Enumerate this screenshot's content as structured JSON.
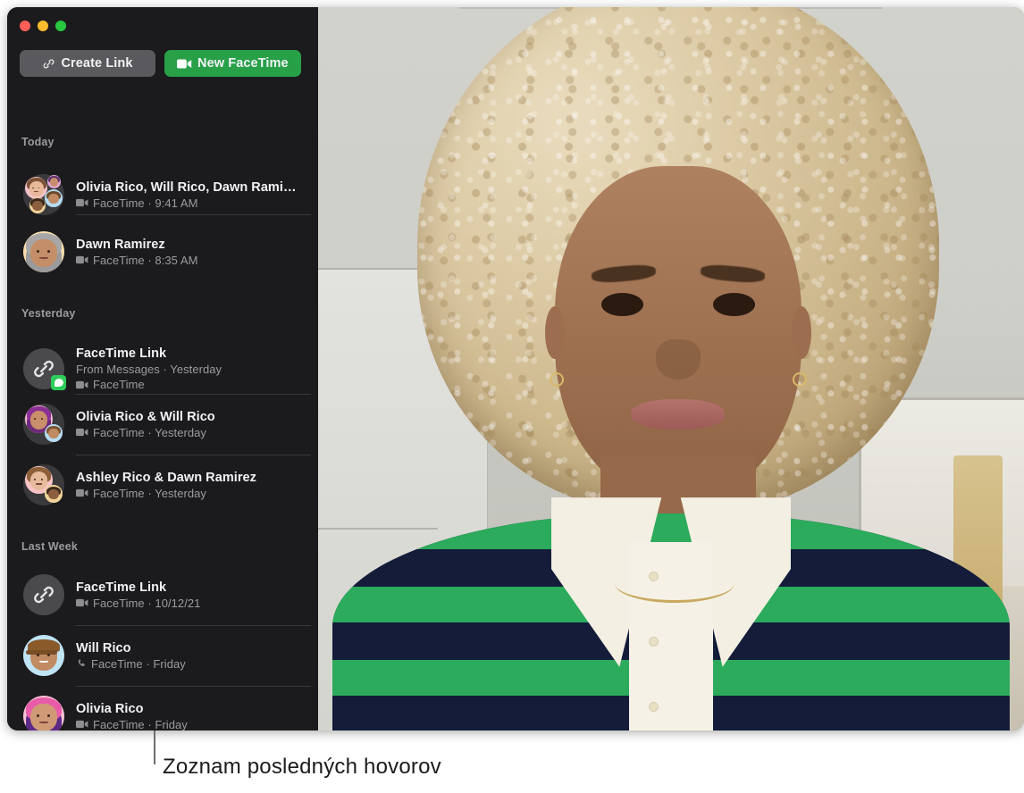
{
  "window": {
    "traffic_lights": [
      {
        "name": "close",
        "color": "#ff5f57"
      },
      {
        "name": "minimize",
        "color": "#febc2e"
      },
      {
        "name": "zoom",
        "color": "#28c840"
      }
    ]
  },
  "toolbar": {
    "create_link_label": "Create Link",
    "create_link_icon": "link-icon",
    "new_facetime_label": "New FaceTime",
    "new_facetime_icon": "video-camera-icon",
    "new_facetime_color": "#28a048"
  },
  "sidebar": {
    "sections": [
      {
        "header": "Today",
        "items": [
          {
            "title": "Olivia Rico, Will Rico, Dawn Rami…",
            "subtitle": "FaceTime · 9:41 AM",
            "call_icon": "video-camera-icon",
            "avatar": "group-four"
          },
          {
            "title": "Dawn Ramirez",
            "subtitle": "FaceTime · 8:35 AM",
            "call_icon": "video-camera-icon",
            "avatar": "memoji-dawn"
          }
        ]
      },
      {
        "header": "Yesterday",
        "items": [
          {
            "title": "FaceTime Link",
            "source": "From Messages · Yesterday",
            "subtitle": "FaceTime",
            "call_icon": "video-camera-icon",
            "avatar": "link-icon",
            "badge": "messages-badge"
          },
          {
            "title": "Olivia Rico & Will Rico",
            "subtitle": "FaceTime · Yesterday",
            "call_icon": "video-camera-icon",
            "avatar": "group-two-olivia-will"
          },
          {
            "title": "Ashley Rico & Dawn Ramirez",
            "subtitle": "FaceTime · Yesterday",
            "call_icon": "video-camera-icon",
            "avatar": "group-two-ashley-dawn"
          }
        ]
      },
      {
        "header": "Last Week",
        "items": [
          {
            "title": "FaceTime Link",
            "subtitle": "FaceTime · 10/12/21",
            "call_icon": "video-camera-icon",
            "avatar": "link-icon"
          },
          {
            "title": "Will Rico",
            "subtitle": "FaceTime · Friday",
            "call_icon": "phone-icon",
            "avatar": "memoji-will"
          },
          {
            "title": "Olivia Rico",
            "subtitle": "FaceTime · Friday",
            "call_icon": "video-camera-icon",
            "avatar": "memoji-olivia"
          }
        ]
      }
    ]
  },
  "video_pane": {
    "description": "video-call-participant"
  },
  "callout": {
    "caption": "Zoznam posledných hovorov"
  }
}
